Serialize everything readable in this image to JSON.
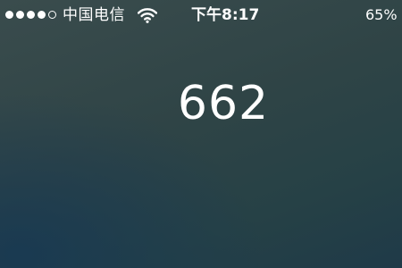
{
  "status_bar": {
    "signal_bars_filled": 4,
    "signal_bars_total": 5,
    "carrier": "中国电信",
    "wifi_icon": "wifi-icon",
    "time": "下午8:17",
    "battery": "65%"
  },
  "main": {
    "code": "662"
  },
  "colors": {
    "text": "#ffffff",
    "background_top": "#3a4c4d",
    "background_bottom": "#1f3a48"
  }
}
